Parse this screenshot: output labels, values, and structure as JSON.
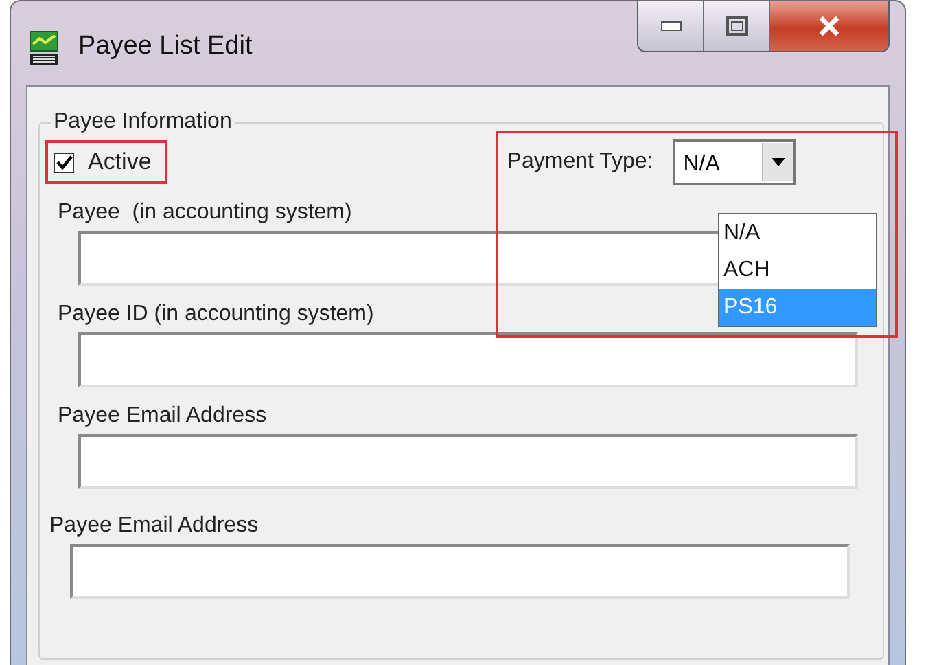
{
  "window": {
    "title": "Payee List Edit"
  },
  "group": {
    "title": "Payee Information"
  },
  "active": {
    "label": "Active",
    "checked": true
  },
  "payment_type": {
    "label": "Payment Type:",
    "value": "N/A",
    "expanded": true,
    "options": [
      {
        "label": "N/A",
        "highlighted": false
      },
      {
        "label": "ACH",
        "highlighted": false
      },
      {
        "label": "PS16",
        "highlighted": true
      }
    ]
  },
  "fields": [
    {
      "label": "Payee  (in accounting system)"
    },
    {
      "label": "Payee ID (in accounting system)"
    },
    {
      "label": "Payee Email Address"
    },
    {
      "label": "Payee Email Address"
    }
  ]
}
